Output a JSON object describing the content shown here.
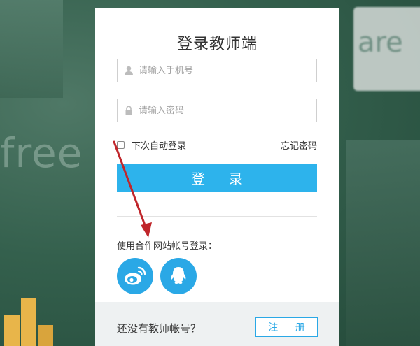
{
  "login": {
    "title": "登录教师端",
    "phone_placeholder": "请输入手机号",
    "password_placeholder": "请输入密码",
    "remember_label": "下次自动登录",
    "forgot_label": "忘记密码",
    "login_button": "登 录",
    "partner_label": "使用合作网站帐号登录："
  },
  "social": [
    {
      "name": "weibo-icon"
    },
    {
      "name": "qq-icon"
    }
  ],
  "footer": {
    "no_account_text": "还没有教师帐号？",
    "register_button": "注 册"
  },
  "background": {
    "blurred_text_1": "are",
    "blurred_text_2": "free"
  },
  "colors": {
    "accent": "#2db3ec",
    "footer_bg": "#eef1f2",
    "annotation_arrow": "#c0262b"
  }
}
